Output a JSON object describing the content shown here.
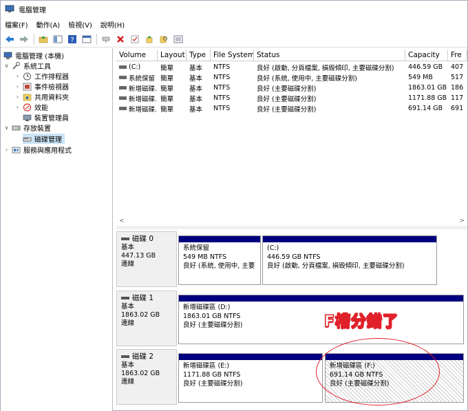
{
  "window": {
    "title": "電腦管理"
  },
  "menu": [
    "檔案(F)",
    "動作(A)",
    "檢視(V)",
    "說明(H)"
  ],
  "toolbar_icons": [
    "back-icon",
    "forward-icon",
    "up-folder-icon",
    "properties-icon",
    "help-icon",
    "console-icon",
    "connect-icon",
    "delete-icon",
    "check-icon",
    "import-icon",
    "search-icon",
    "list-icon"
  ],
  "tree": [
    {
      "label": "電腦管理 (本機)",
      "icon": "computer-management-icon",
      "arrow": ""
    },
    {
      "label": "系統工具",
      "icon": "tools-icon",
      "arrow": "∨"
    },
    {
      "label": "工作排程器",
      "icon": "clock-icon",
      "arrow": "›"
    },
    {
      "label": "事件檢視器",
      "icon": "event-viewer-icon",
      "arrow": "›"
    },
    {
      "label": "共用資料夾",
      "icon": "shared-folder-icon",
      "arrow": "›"
    },
    {
      "label": "效能",
      "icon": "performance-icon",
      "arrow": "›"
    },
    {
      "label": "裝置管理員",
      "icon": "device-manager-icon",
      "arrow": ""
    },
    {
      "label": "存放裝置",
      "icon": "storage-icon",
      "arrow": "∨"
    },
    {
      "label": "磁碟管理",
      "icon": "disk-icon",
      "arrow": ""
    },
    {
      "label": "服務與應用程式",
      "icon": "services-icon",
      "arrow": "›"
    }
  ],
  "table": {
    "headers": [
      "Volume",
      "Layout",
      "Type",
      "File System",
      "Status",
      "Capacity",
      "Fre"
    ],
    "rows": [
      [
        "(C:)",
        "簡單",
        "基本",
        "NTFS",
        "良好 (啟動, 分頁檔案, 損毀傾印, 主要磁碟分割)",
        "446.59 GB",
        "407"
      ],
      [
        "系統保留",
        "簡單",
        "基本",
        "NTFS",
        "良好 (系統, 使用中, 主要磁碟分割)",
        "549 MB",
        "517"
      ],
      [
        "新增磁碟...",
        "簡單",
        "基本",
        "NTFS",
        "良好 (主要磁碟分割)",
        "1863.01 GB",
        "186"
      ],
      [
        "新增磁碟...",
        "簡單",
        "基本",
        "NTFS",
        "良好 (主要磁碟分割)",
        "1171.88 GB",
        "117"
      ],
      [
        "新增磁碟...",
        "簡單",
        "基本",
        "NTFS",
        "良好 (主要磁碟分割)",
        "691.14 GB",
        "691"
      ]
    ]
  },
  "disks": [
    {
      "name": "磁碟 0",
      "type": "基本",
      "size": "447.13 GB",
      "state": "連線",
      "parts": [
        {
          "name": "系統保留",
          "size": "549 MB NTFS",
          "status": "良好 (系統, 使用中, 主要"
        },
        {
          "name": "(C:)",
          "size": "446.59 GB NTFS",
          "status": "良好 (啟動, 分頁檔案, 損毀傾印, 主要磁碟分割)"
        }
      ]
    },
    {
      "name": "磁碟 1",
      "type": "基本",
      "size": "1863.02 GB",
      "state": "連線",
      "parts": [
        {
          "name": "新增磁碟區 (D:)",
          "size": "1863.01 GB NTFS",
          "status": "良好 (主要磁碟分割)"
        }
      ]
    },
    {
      "name": "磁碟 2",
      "type": "基本",
      "size": "1863.02 GB",
      "state": "連線",
      "parts": [
        {
          "name": "新增磁碟區 (E:)",
          "size": "1171.88 GB NTFS",
          "status": "良好 (主要磁碟分割)"
        },
        {
          "name": "新增磁碟區 (F:)",
          "size": "691.14 GB NTFS",
          "status": "良好 (主要磁碟分割)"
        }
      ]
    }
  ],
  "annotation": {
    "text": "F槽分錯了"
  },
  "colors": {
    "partition_bar": "#00007f",
    "annotation": "#e0212a",
    "selection": "#cce4f7"
  }
}
